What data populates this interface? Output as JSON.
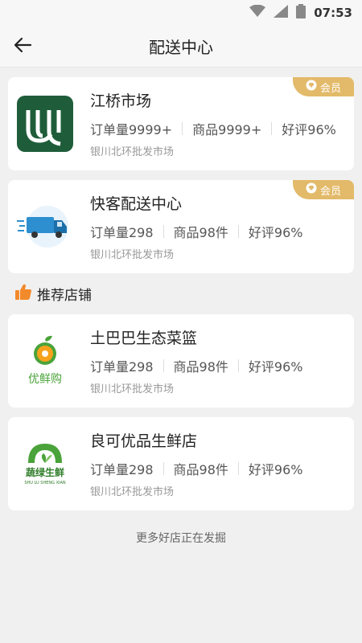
{
  "status_bar": {
    "time": "07:53"
  },
  "header": {
    "title": "配送中心"
  },
  "vip_label": "会员",
  "featured_stores": [
    {
      "name": "江桥市场",
      "orders": "订单量9999+",
      "products": "商品9999+",
      "rating": "好评96%",
      "address": "银川北环批发市场",
      "vip": true
    },
    {
      "name": "快客配送中心",
      "orders": "订单量298",
      "products": "商品98件",
      "rating": "好评96%",
      "address": "银川北环批发市场",
      "vip": true
    }
  ],
  "recommended_section": {
    "title": "推荐店铺"
  },
  "recommended_stores": [
    {
      "name": "土巴巴生态菜篮",
      "orders": "订单量298",
      "products": "商品98件",
      "rating": "好评96%",
      "address": "银川北环批发市场",
      "logo_text": "优鲜购"
    },
    {
      "name": "良可优品生鲜店",
      "orders": "订单量298",
      "products": "商品98件",
      "rating": "好评96%",
      "address": "银川北环批发市场",
      "logo_text": "蔬绿生鲜",
      "logo_subtext": "SHU LU SHENG XIAN"
    }
  ],
  "footer": {
    "text": "更多好店正在发掘"
  },
  "colors": {
    "vip_gold": "#e3ba6a",
    "jiangqiao_green": "#1f5d3a",
    "truck_blue": "#2d8fd0",
    "thumb_orange": "#f28a2b",
    "fresh_green": "#4aa33a"
  }
}
